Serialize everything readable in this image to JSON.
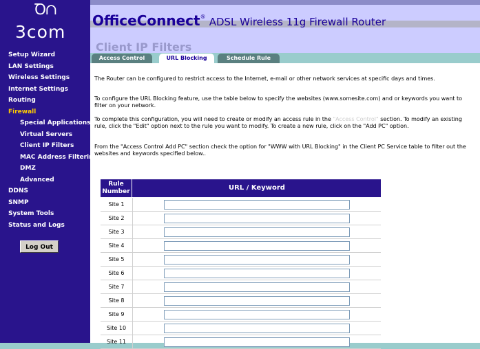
{
  "brand": {
    "logo_swirl": "Ꝺ∩",
    "logo_text": "3com"
  },
  "header": {
    "product_name": "OfficeConnect",
    "registered_mark": "®",
    "product_model": "ADSL Wireless 11g Firewall Router",
    "page_title": "Client IP Filters"
  },
  "sidebar": {
    "items": [
      {
        "label": "Setup Wizard"
      },
      {
        "label": "LAN Settings"
      },
      {
        "label": "Wireless Settings"
      },
      {
        "label": "Internet Settings"
      },
      {
        "label": "Routing"
      },
      {
        "label": "Firewall"
      },
      {
        "label": "Special Applications"
      },
      {
        "label": "Virtual Servers"
      },
      {
        "label": "Client IP Filters"
      },
      {
        "label": "MAC Address Filtering"
      },
      {
        "label": "DMZ"
      },
      {
        "label": "Advanced"
      },
      {
        "label": "DDNS"
      },
      {
        "label": "SNMP"
      },
      {
        "label": "System Tools"
      },
      {
        "label": "Status and Logs"
      }
    ],
    "logout_label": "Log Out"
  },
  "tabs": [
    {
      "label": "Access Control"
    },
    {
      "label": "URL Blocking"
    },
    {
      "label": "Schedule Rule"
    }
  ],
  "content": {
    "p1": "The Router can be configured to restrict access to the Internet, e-mail or other network services at specific days and times.",
    "p2": "To configure the URL Blocking feature, use the table below to specify the websites (www.somesite.com) and or keywords you want to filter on your network.",
    "p3_a": "To complete this configuration, you will need to create or modify an access rule in the ",
    "p3_link": "\"Access Control\"",
    "p3_b": " section. To modify an existing rule, click the \"Edit\" option next to the rule you want to modify. To create a new rule, click on the \"Add PC\" option.",
    "p4": "From the \"Access Control Add PC\" section check the option for \"WWW with URL Blocking\" in the Client PC Service table to filter out the websites and keywords specified below.."
  },
  "table": {
    "header_num": "Rule Number",
    "header_url": "URL / Keyword",
    "rows": [
      {
        "label": "Site  1",
        "value": ""
      },
      {
        "label": "Site  2",
        "value": ""
      },
      {
        "label": "Site  3",
        "value": ""
      },
      {
        "label": "Site  4",
        "value": ""
      },
      {
        "label": "Site  5",
        "value": ""
      },
      {
        "label": "Site  6",
        "value": ""
      },
      {
        "label": "Site  7",
        "value": ""
      },
      {
        "label": "Site  8",
        "value": ""
      },
      {
        "label": "Site  9",
        "value": ""
      },
      {
        "label": "Site  10",
        "value": ""
      },
      {
        "label": "Site  11",
        "value": ""
      }
    ]
  }
}
